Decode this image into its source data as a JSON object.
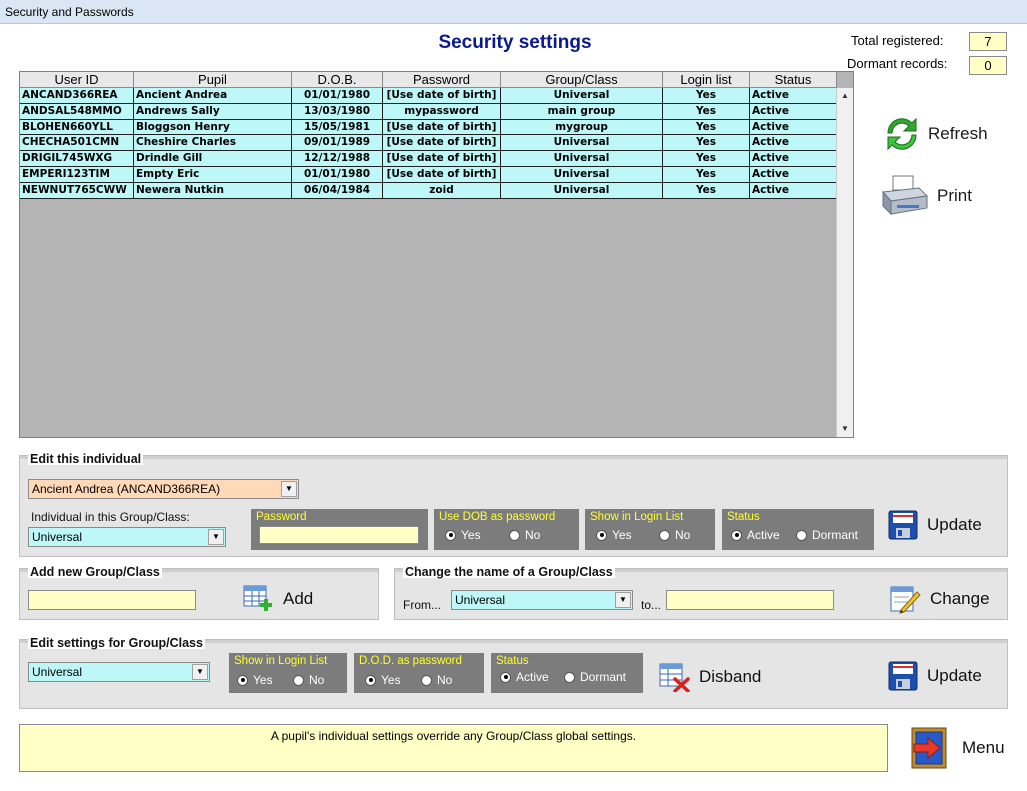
{
  "window": {
    "title": "Security and Passwords"
  },
  "header": {
    "title": "Security settings"
  },
  "stats": {
    "total_label": "Total registered:",
    "total_value": "7",
    "dormant_label": "Dormant records:",
    "dormant_value": "0"
  },
  "grid": {
    "columns": [
      "User ID",
      "Pupil",
      "D.O.B.",
      "Password",
      "Group/Class",
      "Login list",
      "Status"
    ],
    "rows": [
      [
        "ANCAND366REA",
        "Ancient Andrea",
        "01/01/1980",
        "[Use date of birth]",
        "Universal",
        "Yes",
        "Active"
      ],
      [
        "ANDSAL548MMO",
        "Andrews Sally",
        "13/03/1980",
        "mypassword",
        "main group",
        "Yes",
        "Active"
      ],
      [
        "BLOHEN660YLL",
        "Bloggson Henry",
        "15/05/1981",
        "[Use date of birth]",
        "mygroup",
        "Yes",
        "Active"
      ],
      [
        "CHECHA501CMN",
        "Cheshire Charles",
        "09/01/1989",
        "[Use date of birth]",
        "Universal",
        "Yes",
        "Active"
      ],
      [
        "DRIGIL745WXG",
        "Drindle Gill",
        "12/12/1988",
        "[Use date of birth]",
        "Universal",
        "Yes",
        "Active"
      ],
      [
        "EMPERI123TIM",
        "Empty Eric",
        "01/01/1980",
        "[Use date of birth]",
        "Universal",
        "Yes",
        "Active"
      ],
      [
        "NEWNUT765CWW",
        "Newera Nutkin",
        "06/04/1984",
        "zoid",
        "Universal",
        "Yes",
        "Active"
      ]
    ]
  },
  "side": {
    "refresh": "Refresh",
    "print": "Print"
  },
  "edit_individual": {
    "title": "Edit this individual",
    "selected": "Ancient Andrea (ANCAND366REA)",
    "group_label": "Individual in this Group/Class:",
    "group_value": "Universal",
    "password_title": "Password",
    "password_value": "",
    "dob_title": "Use DOB as password",
    "login_title": "Show in Login List",
    "status_title": "Status",
    "yes": "Yes",
    "no": "No",
    "active": "Active",
    "dormant": "Dormant",
    "update": "Update"
  },
  "add_group": {
    "title": "Add new Group/Class",
    "value": "",
    "add": "Add"
  },
  "change_group": {
    "title": "Change the name of a Group/Class",
    "from_label": "From...",
    "from_value": "Universal",
    "to_label": "to...",
    "to_value": "",
    "change": "Change"
  },
  "edit_group": {
    "title": "Edit settings for Group/Class",
    "selected": "Universal",
    "login_title": "Show in Login List",
    "dob_title": "D.O.D. as password",
    "status_title": "Status",
    "yes": "Yes",
    "no": "No",
    "active": "Active",
    "dormant": "Dormant",
    "disband": "Disband",
    "update": "Update"
  },
  "note": {
    "text": "A pupil's individual settings override any Group/Class global settings."
  },
  "menu": {
    "label": "Menu"
  },
  "colors": {
    "cyan_row": "#bdf7f7",
    "yellow_field": "#ffffc6",
    "title_blue": "#0a1a8c",
    "panel_gray": "#7c7c7c",
    "panel_title": "#ffff33"
  }
}
